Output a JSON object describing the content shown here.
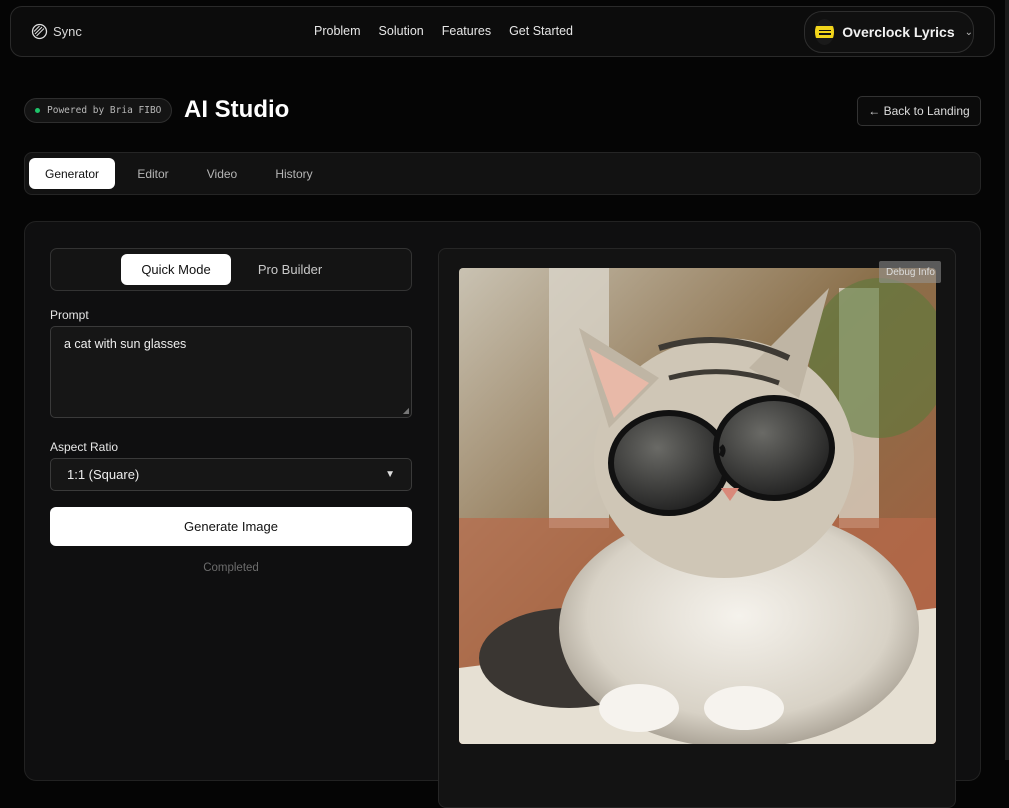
{
  "nav": {
    "brand": "Sync",
    "links": [
      "Problem",
      "Solution",
      "Features",
      "Get Started"
    ],
    "account": {
      "name": "Overclock Lyrics",
      "avatar_icon": "album-art-icon"
    }
  },
  "header": {
    "badge": "Powered by Bria FIBO",
    "title": "AI Studio",
    "back_label": "← Back to Landing"
  },
  "tabs": [
    {
      "label": "Generator",
      "active": true
    },
    {
      "label": "Editor",
      "active": false
    },
    {
      "label": "Video",
      "active": false
    },
    {
      "label": "History",
      "active": false
    }
  ],
  "generator": {
    "modes": [
      {
        "label": "Quick Mode",
        "active": true
      },
      {
        "label": "Pro Builder",
        "active": false
      }
    ],
    "prompt_label": "Prompt",
    "prompt_value": "a cat with sun glasses",
    "aspect_label": "Aspect Ratio",
    "aspect_value": "1:1 (Square)",
    "generate_label": "Generate Image",
    "status": "Completed"
  },
  "preview": {
    "debug_label": "Debug Info",
    "image_subject": "cat wearing round sunglasses"
  },
  "colors": {
    "background": "#050505",
    "panel": "#0f0f10",
    "status_dot": "#1ec46a",
    "button_light": "#ffffff"
  }
}
